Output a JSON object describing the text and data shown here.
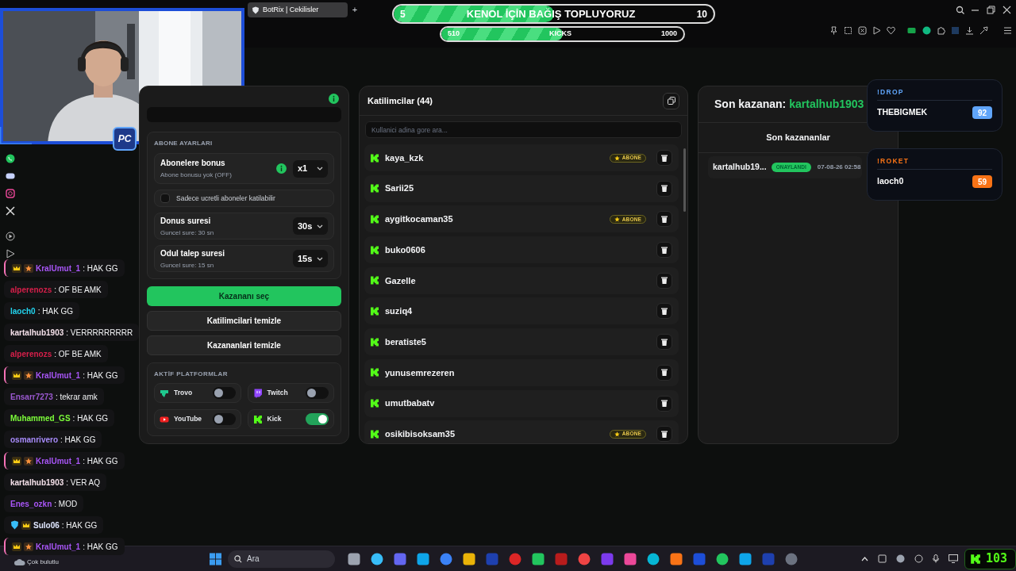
{
  "browser": {
    "tab": {
      "title": "BotRix | Cekilisler",
      "selected": true
    },
    "new_tab": "+"
  },
  "donation_goal": {
    "start": "5",
    "title": "KENOL İÇİN BAĞIŞ TOPLUYORUZ",
    "end": "10",
    "level": 0.5
  },
  "kicks_goal": {
    "start": "510",
    "title": "KICKS",
    "end": "1000",
    "level": 0.5
  },
  "webcam_badge": "PC",
  "chat": [
    {
      "kind": "vip",
      "user": "KralUmut_1",
      "color": "#a855f7",
      "text": ": HAK GG",
      "highlighted": true
    },
    {
      "kind": "plain",
      "user": "alperenozs",
      "color": "#d61f4a",
      "text": ": OF BE AMK",
      "highlighted": false
    },
    {
      "kind": "plain",
      "user": "laoch0",
      "color": "#22d3ee",
      "text": ": HAK GG",
      "highlighted": false
    },
    {
      "kind": "plain",
      "user": "kartalhub1903",
      "color": "#f5e1ea",
      "text": ": VERRRRRRRRR",
      "highlighted": false
    },
    {
      "kind": "plain",
      "user": "alperenozs",
      "color": "#d61f4a",
      "text": ": OF BE AMK",
      "highlighted": false
    },
    {
      "kind": "vip",
      "user": "KralUmut_1",
      "color": "#a855f7",
      "text": ": HAK GG",
      "highlighted": true
    },
    {
      "kind": "plain",
      "user": "Ensarr7273",
      "color": "#9b59d0",
      "text": ": tekrar amk",
      "highlighted": false
    },
    {
      "kind": "plain",
      "user": "Muhammed_GS",
      "color": "#7cfc3a",
      "text": ": HAK GG",
      "highlighted": false
    },
    {
      "kind": "plain",
      "user": "osmanrivero",
      "color": "#a78bfa",
      "text": ": HAK GG",
      "highlighted": false
    },
    {
      "kind": "vip",
      "user": "KralUmut_1",
      "color": "#a855f7",
      "text": ": HAK GG",
      "highlighted": true
    },
    {
      "kind": "plain",
      "user": "kartalhub1903",
      "color": "#f5e1ea",
      "text": ": VER AQ",
      "highlighted": false
    },
    {
      "kind": "plain",
      "user": "Enes_ozkn",
      "color": "#a855f7",
      "text": ": MOD",
      "highlighted": false
    },
    {
      "kind": "mod",
      "user": "Sulo06",
      "color": "#e0e7ff",
      "text": ": HAK GG",
      "highlighted": false
    },
    {
      "kind": "vip",
      "user": "KralUmut_1",
      "color": "#a855f7",
      "text": ": HAK GG",
      "highlighted": true
    }
  ],
  "weather": "Çok bulutlu",
  "settings": {
    "section_title": "ABONE AYARLARI",
    "rows": [
      {
        "kind": "select",
        "title": "Abonelere bonus",
        "subtitle": "Abone bonusu yok (OFF)",
        "info": true,
        "value": "x1"
      },
      {
        "kind": "checkbox",
        "label": "Sadece ucretli aboneler katilabilir",
        "checked": false
      },
      {
        "kind": "select",
        "title": "Donus suresi",
        "subtitle": "Guncel sure: 30 sn",
        "info": false,
        "value": "30s"
      },
      {
        "kind": "select",
        "title": "Odul talep suresi",
        "subtitle": "Guncel sure: 15 sn",
        "info": false,
        "value": "15s"
      }
    ]
  },
  "actions": [
    {
      "label": "Kazananı seç",
      "primary": true
    },
    {
      "label": "Katilimcilari temizle",
      "primary": false
    },
    {
      "label": "Kazananlari temizle",
      "primary": false
    }
  ],
  "platforms": {
    "title": "AKTİF PLATFORMLAR",
    "items": [
      {
        "kind": "trovo",
        "name": "Trovo",
        "on": false
      },
      {
        "kind": "twitch",
        "name": "Twitch",
        "on": false
      },
      {
        "kind": "youtube",
        "name": "YouTube",
        "on": false
      },
      {
        "kind": "kick",
        "name": "Kick",
        "on": true
      }
    ]
  },
  "participants": {
    "title": "Katilimcilar (44)",
    "search_placeholder": "Kullanici adina gore ara...",
    "rows": [
      {
        "name": "kaya_kzk",
        "badge": "ABONE"
      },
      {
        "name": "Sarii25"
      },
      {
        "name": "aygitkocaman35",
        "badge": "ABONE"
      },
      {
        "name": "buko0606"
      },
      {
        "name": "Gazelle"
      },
      {
        "name": "suziq4"
      },
      {
        "name": "beratiste5"
      },
      {
        "name": "yunusemrezeren"
      },
      {
        "name": "umutbabatv"
      },
      {
        "name": "osikibisoksam35",
        "badge": "ABONE"
      }
    ]
  },
  "winner": {
    "label": "Son kazanan:",
    "name": "kartalhub1903",
    "list_title": "Son kazananlar",
    "rows": [
      {
        "name": "kartalhub19...",
        "status": "ONAYLANDI",
        "date": "07-08-26 02:58"
      }
    ]
  },
  "widgets": [
    {
      "command": "!DROP",
      "user": "THEBIGMEK",
      "score": "92",
      "color": "#60a5fa"
    },
    {
      "command": "!ROKET",
      "user": "laoch0",
      "score": "59",
      "color": "#f97316"
    }
  ],
  "taskbar": {
    "search_placeholder": "Ara",
    "counter": "103"
  }
}
